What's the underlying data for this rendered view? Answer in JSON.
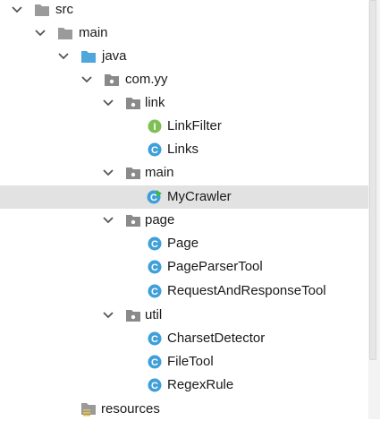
{
  "tree": {
    "items": [
      {
        "label": "src",
        "kind": "folder-gray",
        "expanded": true
      },
      {
        "label": "main",
        "kind": "folder-gray",
        "expanded": true
      },
      {
        "label": "java",
        "kind": "folder-blue",
        "expanded": true
      },
      {
        "label": "com.yy",
        "kind": "package",
        "expanded": true
      },
      {
        "label": "link",
        "kind": "package",
        "expanded": true
      },
      {
        "label": "LinkFilter",
        "kind": "interface"
      },
      {
        "label": "Links",
        "kind": "class"
      },
      {
        "label": "main",
        "kind": "package",
        "expanded": true
      },
      {
        "label": "MyCrawler",
        "kind": "class-main",
        "selected": true
      },
      {
        "label": "page",
        "kind": "package",
        "expanded": true
      },
      {
        "label": "Page",
        "kind": "class"
      },
      {
        "label": "PageParserTool",
        "kind": "class"
      },
      {
        "label": "RequestAndResponseTool",
        "kind": "class"
      },
      {
        "label": "util",
        "kind": "package",
        "expanded": true
      },
      {
        "label": "CharsetDetector",
        "kind": "class"
      },
      {
        "label": "FileTool",
        "kind": "class"
      },
      {
        "label": "RegexRule",
        "kind": "class"
      },
      {
        "label": "resources",
        "kind": "resources-folder"
      }
    ]
  },
  "colors": {
    "folder_gray": "#9a9a9a",
    "folder_blue": "#4ea6dc",
    "package": "#8a8a8a",
    "class_icon": "#3f9fd8",
    "interface_icon": "#7fbf55",
    "run_marker": "#3dba3d",
    "selection": "#e2e2e2"
  }
}
